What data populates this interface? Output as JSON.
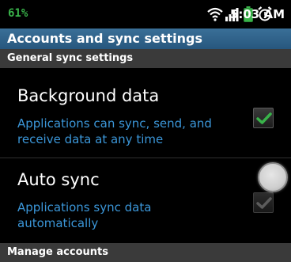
{
  "status_bar": {
    "left_indicator": "61%",
    "time": "5:03 AM",
    "icons": [
      "wifi-icon",
      "signal-icon",
      "battery-icon",
      "alarm-icon"
    ]
  },
  "header": {
    "title": "Accounts and sync settings"
  },
  "sections": {
    "general": {
      "label": "General sync settings"
    },
    "manage": {
      "label": "Manage accounts"
    }
  },
  "settings": {
    "background_data": {
      "title": "Background data",
      "summary": "Applications can sync, send, and receive data at any time",
      "checked": true,
      "enabled": true
    },
    "auto_sync": {
      "title": "Auto sync",
      "summary": "Applications sync data automatically",
      "checked": true,
      "enabled": false
    }
  },
  "colors": {
    "accent_green": "#39b34a",
    "summary_blue": "#3b96d8",
    "title_bar": "#2c5d84",
    "section_header": "#3a3a3a"
  }
}
